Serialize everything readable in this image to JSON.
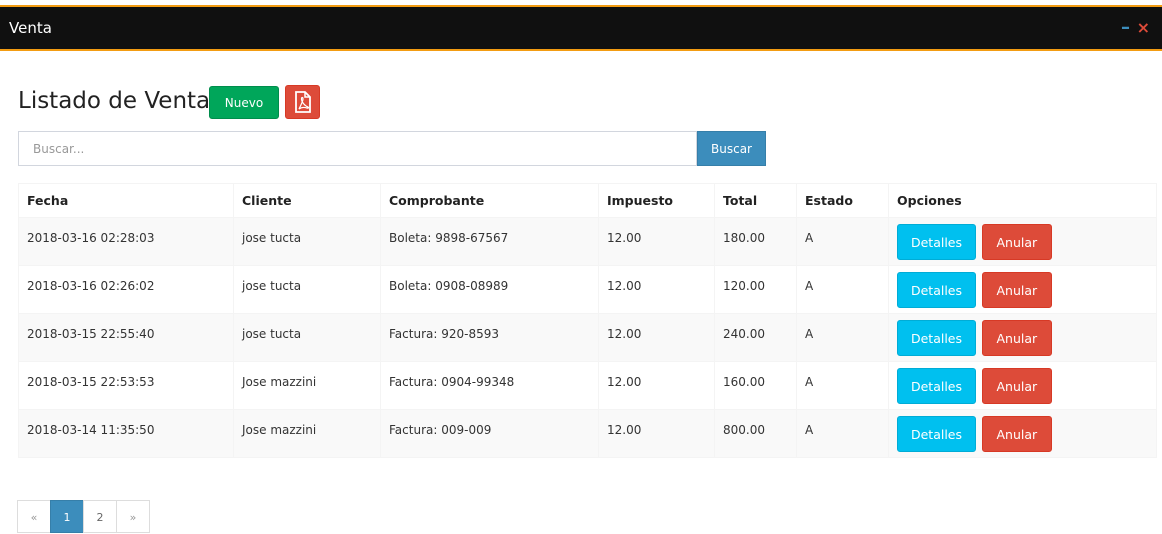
{
  "window": {
    "title": "Venta",
    "minimize_glyph": "–",
    "close_glyph": "×",
    "accent_color": "#f39c12"
  },
  "header": {
    "title": "Listado de Ventas",
    "new_label": "Nuevo",
    "pdf_icon": "pdf-icon"
  },
  "search": {
    "placeholder": "Buscar...",
    "value": "",
    "button_label": "Buscar"
  },
  "table": {
    "columns": [
      "Fecha",
      "Cliente",
      "Comprobante",
      "Impuesto",
      "Total",
      "Estado",
      "Opciones"
    ],
    "rows": [
      {
        "fecha": "2018-03-16 02:28:03",
        "cliente": "jose tucta",
        "comprobante": "Boleta: 9898-67567",
        "impuesto": "12.00",
        "total": "180.00",
        "estado": "A"
      },
      {
        "fecha": "2018-03-16 02:26:02",
        "cliente": "jose tucta",
        "comprobante": "Boleta: 0908-08989",
        "impuesto": "12.00",
        "total": "120.00",
        "estado": "A"
      },
      {
        "fecha": "2018-03-15 22:55:40",
        "cliente": "jose tucta",
        "comprobante": "Factura: 920-8593",
        "impuesto": "12.00",
        "total": "240.00",
        "estado": "A"
      },
      {
        "fecha": "2018-03-15 22:53:53",
        "cliente": "Jose mazzini",
        "comprobante": "Factura: 0904-99348",
        "impuesto": "12.00",
        "total": "160.00",
        "estado": "A"
      },
      {
        "fecha": "2018-03-14 11:35:50",
        "cliente": "Jose mazzini",
        "comprobante": "Factura: 009-009",
        "impuesto": "12.00",
        "total": "800.00",
        "estado": "A"
      }
    ],
    "details_label": "Detalles",
    "cancel_label": "Anular"
  },
  "pagination": {
    "prev": "«",
    "pages": [
      "1",
      "2"
    ],
    "active_page": "1",
    "next": "»"
  }
}
